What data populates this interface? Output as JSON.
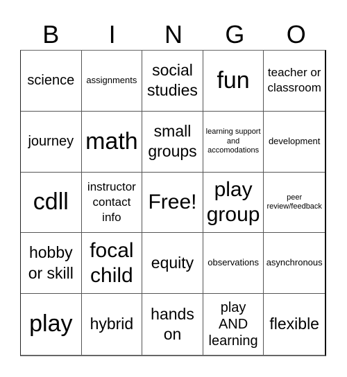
{
  "header": {
    "letters": [
      "B",
      "I",
      "N",
      "G",
      "O"
    ]
  },
  "board": {
    "rows": [
      [
        {
          "text": "science",
          "size": "lg"
        },
        {
          "text": "assignments",
          "size": "sm"
        },
        {
          "text": "social studies",
          "size": "xl"
        },
        {
          "text": "fun",
          "size": "huge"
        },
        {
          "text": "teacher or classroom",
          "size": "md"
        }
      ],
      [
        {
          "text": "journey",
          "size": "lg"
        },
        {
          "text": "math",
          "size": "huge"
        },
        {
          "text": "small groups",
          "size": "xl"
        },
        {
          "text": "learning support and accomodations",
          "size": "xs"
        },
        {
          "text": "development",
          "size": "sm"
        }
      ],
      [
        {
          "text": "cdll",
          "size": "huge"
        },
        {
          "text": "instructor contact info",
          "size": "md"
        },
        {
          "text": "Free!",
          "size": "xxl"
        },
        {
          "text": "play group",
          "size": "xxl"
        },
        {
          "text": "peer review/feedback",
          "size": "xs"
        }
      ],
      [
        {
          "text": "hobby or skill",
          "size": "xl"
        },
        {
          "text": "focal child",
          "size": "xxl"
        },
        {
          "text": "equity",
          "size": "xl"
        },
        {
          "text": "observations",
          "size": "sm"
        },
        {
          "text": "asynchronous",
          "size": "sm"
        }
      ],
      [
        {
          "text": "play",
          "size": "huge"
        },
        {
          "text": "hybrid",
          "size": "xl"
        },
        {
          "text": "hands on",
          "size": "xl"
        },
        {
          "text": "play AND learning",
          "size": "lg"
        },
        {
          "text": "flexible",
          "size": "xl"
        }
      ]
    ]
  }
}
